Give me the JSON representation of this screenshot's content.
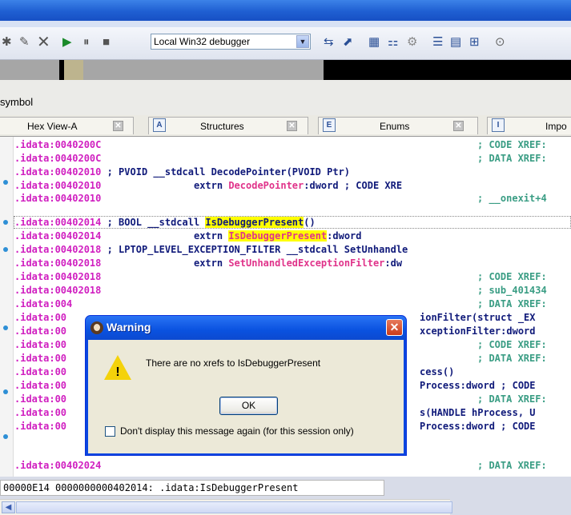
{
  "toolbar": {
    "debugger_select": "Local Win32 debugger",
    "icons": [
      "add-icon",
      "edit-icon",
      "delete-icon",
      "play-icon",
      "pause-icon",
      "stop-icon",
      "chevron-down-icon"
    ]
  },
  "symbol_label": "symbol",
  "tabs": [
    {
      "label": "Hex View-A"
    },
    {
      "label": "Structures"
    },
    {
      "label": "Enums"
    },
    {
      "label": "Impo"
    }
  ],
  "listing": [
    {
      "addr": ".idata:0040200C",
      "rest": "",
      "tail": "; CODE XREF:"
    },
    {
      "addr": ".idata:0040200C",
      "rest": "",
      "tail": "; DATA XREF:"
    },
    {
      "addr": ".idata:00402010",
      "rest": " ; PVOID __stdcall DecodePointer(PVOID Ptr)",
      "tail": ""
    },
    {
      "addr": ".idata:00402010",
      "rest": "                extrn DecodePointer:dword ; CODE XRE",
      "tail": ""
    },
    {
      "addr": ".idata:00402010",
      "rest": "",
      "tail": "; __onexit+4"
    },
    {
      "addr": ".idata:00402014",
      "rest": " ; BOOL __stdcall IsDebuggerPresent()",
      "tail": ""
    },
    {
      "addr": ".idata:00402014",
      "rest": "                extrn IsDebuggerPresent:dword",
      "tail": ""
    },
    {
      "addr": ".idata:00402018",
      "rest": " ; LPTOP_LEVEL_EXCEPTION_FILTER __stdcall SetUnhandle",
      "tail": ""
    },
    {
      "addr": ".idata:00402018",
      "rest": "                extrn SetUnhandledExceptionFilter:dw",
      "tail": ""
    },
    {
      "addr": ".idata:00402018",
      "rest": "",
      "tail": "; CODE XREF:"
    },
    {
      "addr": ".idata:00402018",
      "rest": "",
      "tail": "; sub_401434"
    },
    {
      "addr": ".idata:004",
      "rest": "",
      "tail": "; DATA XREF:"
    },
    {
      "addr": ".idata:00",
      "rest": "",
      "tail": "ionFilter(struct _EX"
    },
    {
      "addr": ".idata:00",
      "rest": "",
      "tail": "xceptionFilter:dword"
    },
    {
      "addr": ".idata:00",
      "rest": "",
      "tail": "; CODE XREF:"
    },
    {
      "addr": ".idata:00",
      "rest": "",
      "tail": "; DATA XREF:"
    },
    {
      "addr": ".idata:00",
      "rest": "",
      "tail": "cess()"
    },
    {
      "addr": ".idata:00",
      "rest": "",
      "tail": "Process:dword ; CODE"
    },
    {
      "addr": ".idata:00",
      "rest": "",
      "tail": "; DATA XREF:"
    },
    {
      "addr": ".idata:00",
      "rest": "",
      "tail": "s(HANDLE hProcess, U"
    },
    {
      "addr": ".idata:00",
      "rest": "",
      "tail": "Process:dword ; CODE"
    },
    {
      "addr": ".idata:00402024",
      "rest": "",
      "tail": "; DATA XREF:"
    }
  ],
  "status_line": "00000E14 0000000000402014: .idata:IsDebuggerPresent",
  "dialog": {
    "title": "Warning",
    "message": "There are no xrefs to IsDebuggerPresent",
    "ok": "OK",
    "checkbox_label": "Don't display this message again (for this session only)"
  }
}
